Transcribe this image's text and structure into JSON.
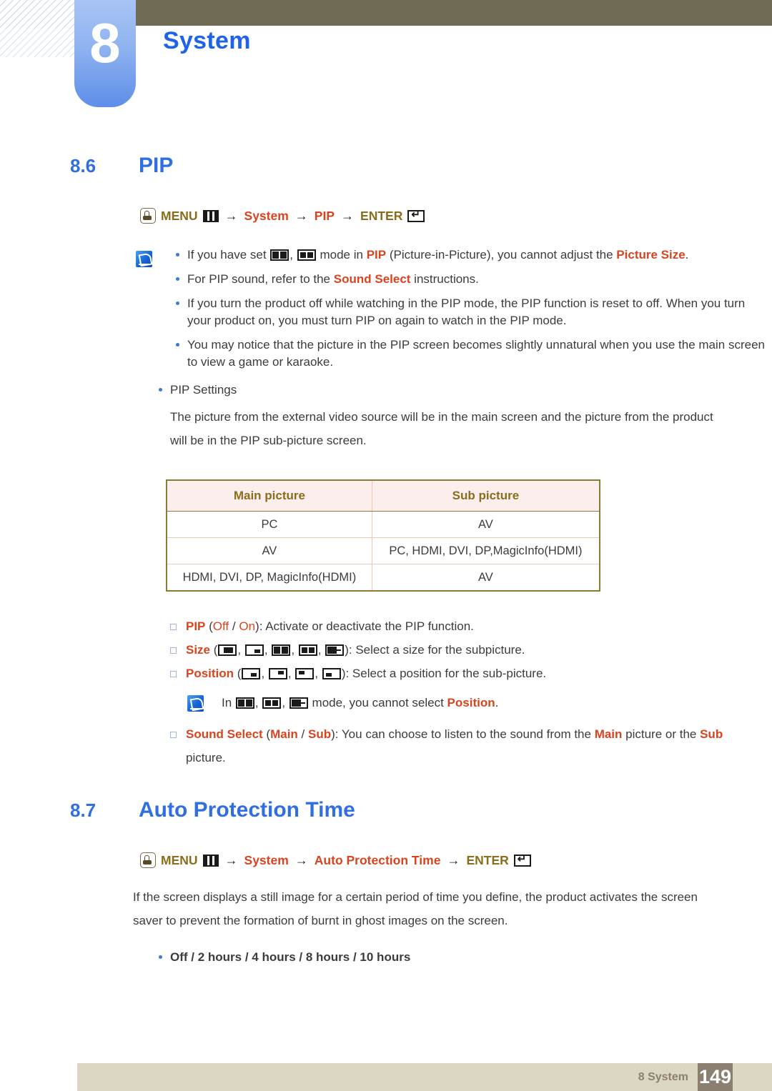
{
  "header": {
    "chapter_number": "8",
    "chapter_title": "System"
  },
  "sections": [
    {
      "number": "8.6",
      "title": "PIP",
      "menu_path": {
        "hand_icon": "hand-press-icon",
        "menu_label": "MENU",
        "grid_icon": "menu-grid-icon",
        "arrow1": "→",
        "system_label": "System",
        "arrow2": "→",
        "target_label": "PIP",
        "arrow3": "→",
        "enter_label": "ENTER",
        "enter_icon": "enter-key-icon"
      }
    },
    {
      "number": "8.7",
      "title": "Auto Protection Time",
      "menu_path": {
        "hand_icon": "hand-press-icon",
        "menu_label": "MENU",
        "grid_icon": "menu-grid-icon",
        "arrow1": "→",
        "system_label": "System",
        "arrow2": "→",
        "target_label": "Auto Protection Time",
        "arrow3": "→",
        "enter_label": "ENTER",
        "enter_icon": "enter-key-icon"
      }
    }
  ],
  "pip_notes": {
    "note_icon": "note-pencil-icon",
    "items": [
      {
        "pre": "If you have set ",
        "icon1": "pip-mode-split-icon",
        "sep": ", ",
        "icon2": "pip-mode-dual-icon",
        "mid": " mode in ",
        "em1": "PIP",
        "mid2": " (Picture-in-Picture), you cannot adjust the ",
        "em2": "Picture Size",
        "post": "."
      },
      {
        "pre": "For PIP sound, refer to the ",
        "em1": "Sound Select",
        "post": " instructions."
      },
      {
        "text": "If you turn the product off while watching in the PIP mode, the PIP function is reset to off. When you turn your product on, you must turn PIP on again to watch in the PIP mode."
      },
      {
        "text": "You may notice that the picture in the PIP screen becomes slightly unnatural when you use the main screen to view a game or karaoke."
      }
    ]
  },
  "pip_settings": {
    "heading": "PIP Settings",
    "description": "The picture from the external video source will be in the main screen and the picture from the product will be in the PIP sub-picture screen."
  },
  "pip_table": {
    "columns": [
      "Main picture",
      "Sub picture"
    ],
    "rows": [
      [
        "PC",
        "AV"
      ],
      [
        "AV",
        "PC, HDMI, DVI, DP,MagicInfo(HDMI)"
      ],
      [
        "HDMI, DVI, DP, MagicInfo(HDMI)",
        "AV"
      ]
    ]
  },
  "pip_options": {
    "pip": {
      "label": "PIP",
      "open": " (",
      "opt1": "Off",
      "slash": " / ",
      "opt2": "On",
      "close": "): ",
      "desc": "Activate or deactivate the PIP function."
    },
    "size": {
      "label": "Size",
      "open": " (",
      "icons": [
        "size-large-icon",
        "size-small-icon",
        "size-split-icon",
        "size-dual-icon",
        "size-wide-icon"
      ],
      "close": "): ",
      "desc": "Select a size for the subpicture."
    },
    "position": {
      "label": "Position",
      "open": " (",
      "icons": [
        "position-bottom-right-icon",
        "position-top-right-icon",
        "position-top-left-icon",
        "position-bottom-left-icon"
      ],
      "close": "): ",
      "desc": "Select a position for the sub-picture."
    },
    "position_note": {
      "note_icon": "note-pencil-icon",
      "pre": "In ",
      "icon1": "pip-mode-split-icon",
      "sep1": ", ",
      "icon2": "pip-mode-dual-icon",
      "sep2": ", ",
      "icon3": "pip-mode-wide-icon",
      "mid": " mode, you cannot select ",
      "em": "Position",
      "post": "."
    },
    "sound_select": {
      "label": "Sound Select",
      "open": " (",
      "opt1": "Main",
      "slash": " / ",
      "opt2": "Sub",
      "close": "): ",
      "desc1": "You can choose to listen to the sound from the ",
      "em1": "Main",
      "desc2": " picture or the ",
      "em2": "Sub",
      "desc3": " picture."
    }
  },
  "auto_protection": {
    "description": "If the screen displays a still image for a certain period of time you define, the product activates the screen saver to prevent the formation of burnt in ghost images on the screen.",
    "options_text": "Off / 2 hours / 4 hours / 8 hours / 10 hours",
    "options": [
      "Off",
      "2 hours",
      "4 hours",
      "8 hours",
      "10 hours"
    ]
  },
  "footer": {
    "label": "8 System",
    "page_number": "149"
  },
  "colors": {
    "heading_blue": "#2f6fe0",
    "accent_red": "#d8441f",
    "menu_gold": "#8a6d1a",
    "olive_bar": "#6f6b55",
    "footer_bar": "#dcd7c3",
    "footer_page_bg": "#8b7f72",
    "tab_blue": "#5e8ee8"
  }
}
